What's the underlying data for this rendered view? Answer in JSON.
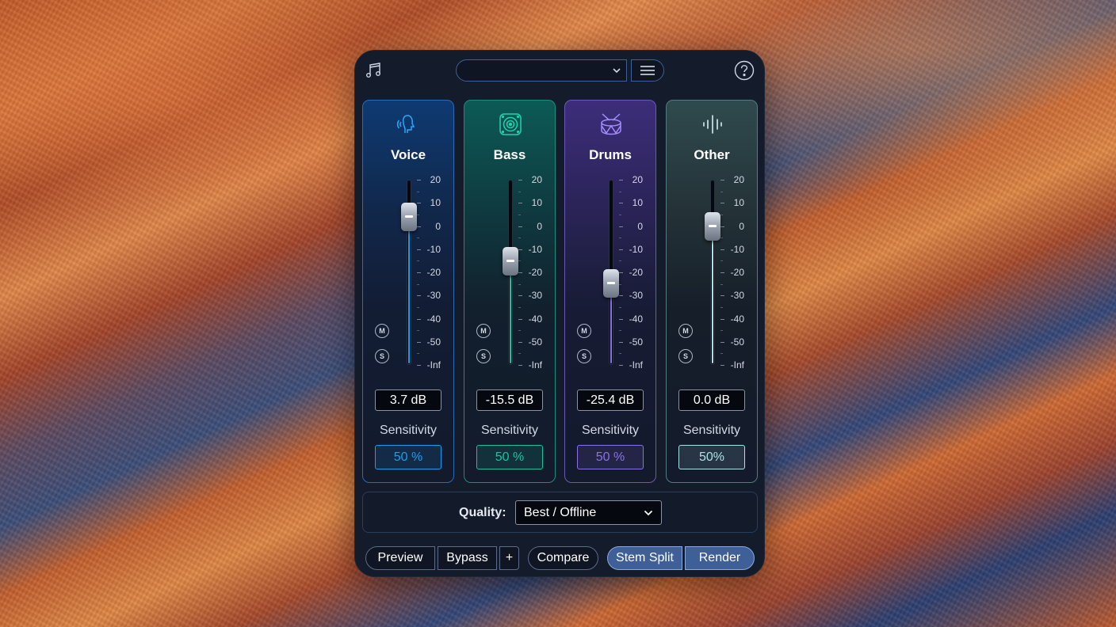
{
  "header": {
    "app_icon": "music-note-icon",
    "preset_value": "",
    "menu_icon": "hamburger-menu-icon",
    "help_icon": "question-mark-icon"
  },
  "scale_labels": [
    "20",
    "10",
    "0",
    "-10",
    "-20",
    "-30",
    "-40",
    "-50",
    "-Inf"
  ],
  "channels": [
    {
      "name": "Voice",
      "icon": "voice-head-icon",
      "gain": "3.7 dB",
      "gain_level_fraction": 0.8,
      "sensitivity_label": "Sensitivity",
      "sensitivity": "50 %",
      "mute": "M",
      "solo": "S",
      "accent": "#1a9cf0"
    },
    {
      "name": "Bass",
      "icon": "speaker-icon",
      "gain": "-15.5 dB",
      "gain_level_fraction": 0.56,
      "sensitivity_label": "Sensitivity",
      "sensitivity": "50 %",
      "mute": "M",
      "solo": "S",
      "accent": "#19c29f"
    },
    {
      "name": "Drums",
      "icon": "drum-icon",
      "gain": "-25.4 dB",
      "gain_level_fraction": 0.44,
      "sensitivity_label": "Sensitivity",
      "sensitivity": "50 %",
      "mute": "M",
      "solo": "S",
      "accent": "#8b71e8"
    },
    {
      "name": "Other",
      "icon": "waveform-icon",
      "gain": "0.0 dB",
      "gain_level_fraction": 0.75,
      "sensitivity_label": "Sensitivity",
      "sensitivity": "50%",
      "mute": "M",
      "solo": "S",
      "accent": "#a9e3e6"
    }
  ],
  "quality": {
    "label": "Quality:",
    "value": "Best / Offline"
  },
  "buttons": {
    "preview": "Preview",
    "bypass": "Bypass",
    "plus": "+",
    "compare": "Compare",
    "stem_split": "Stem Split",
    "render": "Render"
  }
}
